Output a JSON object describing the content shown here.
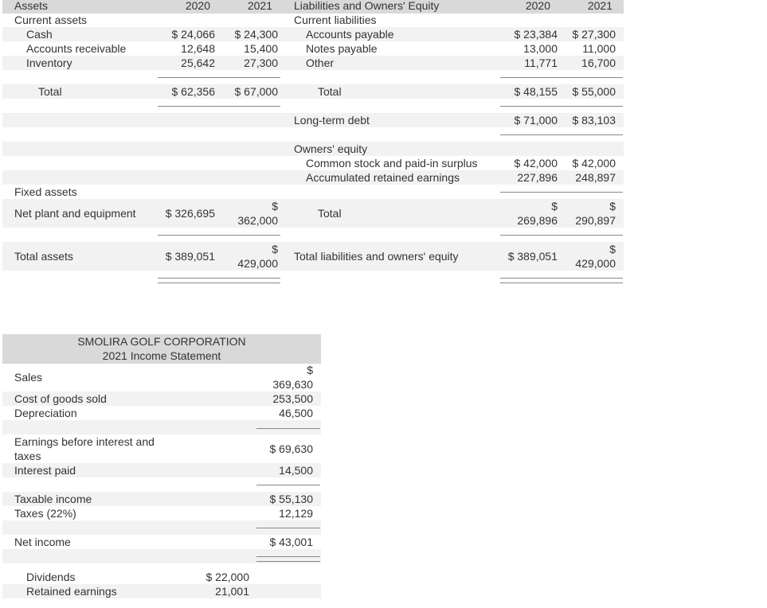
{
  "balance_sheet": {
    "assets_header": "Assets",
    "col_2020": "2020",
    "col_2021": "2021",
    "current_assets_label": "Current assets",
    "cash": {
      "label": "Cash",
      "v2020": "$ 24,066",
      "v2021": "$ 24,300"
    },
    "accounts_receivable": {
      "label": "Accounts receivable",
      "v2020": "12,648",
      "v2021": "15,400"
    },
    "inventory": {
      "label": "Inventory",
      "v2020": "25,642",
      "v2021": "27,300"
    },
    "current_assets_total": {
      "label": "Total",
      "v2020": "$ 62,356",
      "v2021": "$ 67,000"
    },
    "fixed_assets_label": "Fixed assets",
    "net_plant": {
      "label": "Net plant and equipment",
      "v2020": "$ 326,695",
      "v2021_sign": "$",
      "v2021": "362,000"
    },
    "total_assets": {
      "label": "Total assets",
      "v2020": "$ 389,051",
      "v2021_sign": "$",
      "v2021": "429,000"
    },
    "liab_header": "Liabilities and Owners' Equity",
    "current_liabilities_label": "Current liabilities",
    "accounts_payable": {
      "label": "Accounts payable",
      "v2020": "$ 23,384",
      "v2021": "$ 27,300"
    },
    "notes_payable": {
      "label": "Notes payable",
      "v2020": "13,000",
      "v2021": "11,000"
    },
    "other": {
      "label": "Other",
      "v2020": "11,771",
      "v2021": "16,700"
    },
    "current_liab_total": {
      "label": "Total",
      "v2020": "$ 48,155",
      "v2021": "$ 55,000"
    },
    "long_term_debt": {
      "label": "Long-term debt",
      "v2020": "$ 71,000",
      "v2021": "$ 83,103"
    },
    "owners_equity_label": "Owners' equity",
    "common_stock": {
      "label": "Common stock and paid-in surplus",
      "v2020": "$ 42,000",
      "v2021": "$ 42,000"
    },
    "retained_earnings": {
      "label": "Accumulated retained earnings",
      "v2020": "227,896",
      "v2021": "248,897"
    },
    "equity_total": {
      "label": "Total",
      "v2020_sign": "$",
      "v2020": "269,896",
      "v2021_sign": "$",
      "v2021": "290,897"
    },
    "total_liab_equity": {
      "label": "Total liabilities and owners' equity",
      "v2020": "$ 389,051",
      "v2021_sign": "$",
      "v2021": "429,000"
    }
  },
  "income_statement": {
    "company": "SMOLIRA GOLF CORPORATION",
    "title": "2021 Income Statement",
    "sales": {
      "label": "Sales",
      "sign": "$",
      "value": "369,630"
    },
    "cogs": {
      "label": "Cost of goods sold",
      "value": "253,500"
    },
    "depreciation": {
      "label": "Depreciation",
      "value": "46,500"
    },
    "ebit": {
      "label_line1": "Earnings before interest and",
      "label_line2": "taxes",
      "value": "$ 69,630"
    },
    "interest": {
      "label": "Interest paid",
      "value": "14,500"
    },
    "taxable_income": {
      "label": "Taxable income",
      "value": "$ 55,130"
    },
    "taxes": {
      "label": "Taxes (22%)",
      "value": "12,129"
    },
    "net_income": {
      "label": "Net income",
      "value": "$ 43,001"
    },
    "dividends": {
      "label": "Dividends",
      "value": "$ 22,000"
    },
    "retained": {
      "label": "Retained earnings",
      "value": "21,001"
    }
  }
}
